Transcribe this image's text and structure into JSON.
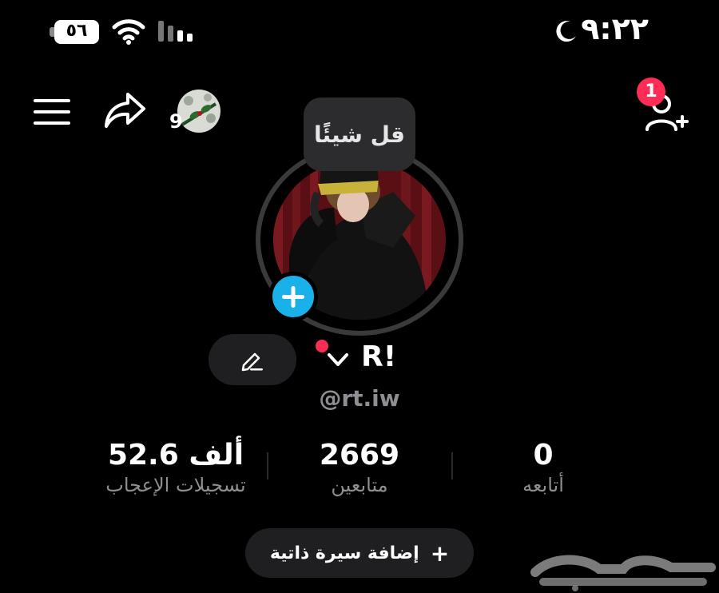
{
  "status_bar": {
    "time": "٩:٢٢",
    "battery": "٥٦",
    "icons": [
      "moon-icon",
      "wifi-icon",
      "signal-icon",
      "battery-icon"
    ]
  },
  "top_nav": {
    "story_count": "9",
    "notification_count": "1",
    "icons": [
      "menu-icon",
      "share-icon",
      "add-friend-icon"
    ]
  },
  "profile": {
    "bubble_text": "قل شيئًا",
    "display_name": "R!",
    "handle": "@rt.iw"
  },
  "stats": {
    "likes_value": "52.6 ألف",
    "likes_label": "تسجيلات الإعجاب",
    "followers_value": "2669",
    "followers_label": "متابعين",
    "following_value": "0",
    "following_label": "أتابعه"
  },
  "bio_button_label": "إضافة سيرة ذاتية",
  "watermark": "حراج",
  "colors": {
    "background": "#000000",
    "accent_blue": "#1ab0ea",
    "badge_red": "#ff2d55",
    "muted_text": "#8e8e93",
    "button_bg": "#1f1f21"
  }
}
